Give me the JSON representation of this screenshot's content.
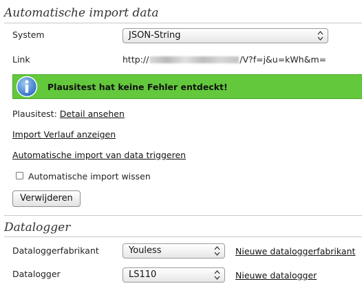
{
  "import_section": {
    "title": "Automatische import data",
    "system_label": "System",
    "system_value": "JSON-String",
    "link_label": "Link",
    "link_prefix": "http://",
    "link_suffix": "/V?f=j&u=kWh&m=",
    "status_message": "Plausitest hat keine Fehler entdeckt!",
    "plausitest_label": "Plausitest:",
    "plausitest_link": "Detail ansehen",
    "history_link": "Import Verlauf anzeigen",
    "trigger_link": "Automatische import van data triggeren",
    "clear_checkbox_label": "Automatische import wissen",
    "clear_checked": false,
    "delete_button": "Verwijderen"
  },
  "datalogger_section": {
    "title": "Datalogger",
    "manufacturer_label": "Dataloggerfabrikant",
    "manufacturer_value": "Youless",
    "new_manufacturer_link": "Nieuwe dataloggerfabrikant",
    "logger_label": "Datalogger",
    "logger_value": "LS110",
    "new_logger_link": "Nieuwe datalogger"
  },
  "colors": {
    "success_green": "#63c83c",
    "info_blue": "#3a7fd0"
  },
  "icons": {
    "status": "info-icon",
    "select": "up-down-arrows-icon"
  }
}
